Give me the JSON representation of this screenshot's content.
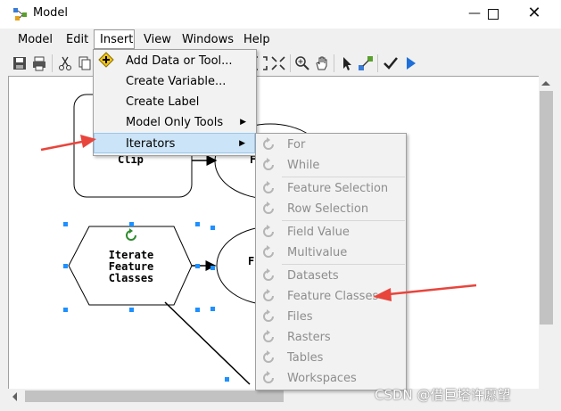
{
  "window": {
    "title": "Model"
  },
  "menubar": {
    "items": [
      "Model",
      "Edit",
      "Insert",
      "View",
      "Windows",
      "Help"
    ]
  },
  "insert_menu": {
    "items": [
      {
        "label": "Add Data or Tool...",
        "submenu": false
      },
      {
        "label": "Create Variable...",
        "submenu": false
      },
      {
        "label": "Create Label",
        "submenu": false
      },
      {
        "label": "Model Only Tools",
        "submenu": true
      },
      {
        "label": "Iterators",
        "submenu": true,
        "highlighted": true
      }
    ]
  },
  "iterators_submenu": {
    "groups": [
      [
        "For",
        "While"
      ],
      [
        "Feature Selection",
        "Row Selection"
      ],
      [
        "Field Value",
        "Multivalue"
      ],
      [
        "Datasets",
        "Feature Classes",
        "Files",
        "Rasters",
        "Tables",
        "Workspaces"
      ]
    ],
    "enabled": false
  },
  "diagram": {
    "tool_label": "Clip",
    "iterator_label_lines": [
      "Iterate",
      "Feature",
      "Classes"
    ],
    "partial_labels": [
      "F",
      "F"
    ]
  },
  "watermark": "CSDN @借巨塔许愿望",
  "colors": {
    "highlight": "#cce4f7",
    "annotation_arrow": "#e8453c",
    "selection_handle": "#1e90ff",
    "disabled_text": "#8d8d8d"
  }
}
